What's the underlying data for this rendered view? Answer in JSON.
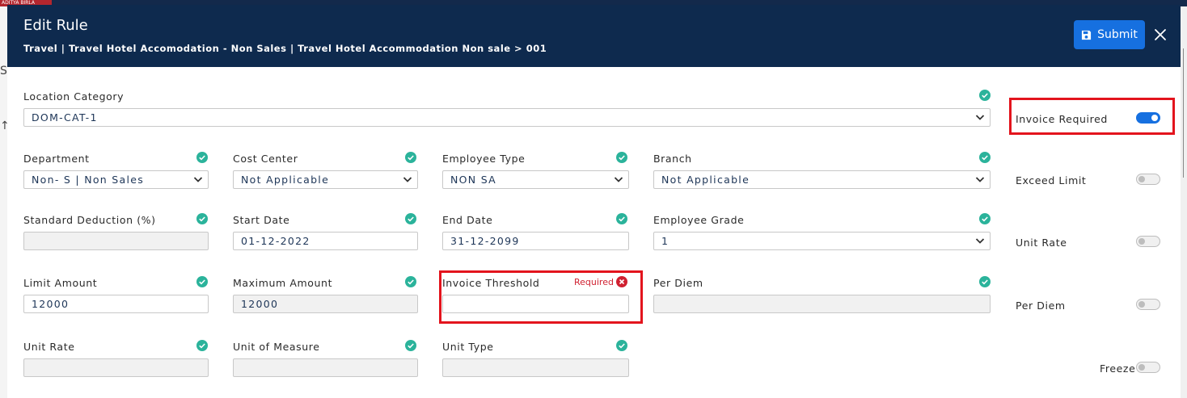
{
  "background": {
    "logo_text": "ADITYA BIRLA",
    "glyph_top": "S",
    "glyph_mid": "↑"
  },
  "header": {
    "title": "Edit Rule",
    "breadcrumb": "Travel | Travel Hotel Accomodation - Non Sales | Travel Hotel Accommodation Non sale > 001",
    "submit_label": "Submit"
  },
  "fields": {
    "location_category": {
      "label": "Location Category",
      "value": "DOM-CAT-1"
    },
    "department": {
      "label": "Department",
      "value": "Non- S | Non Sales"
    },
    "cost_center": {
      "label": "Cost Center",
      "value": "Not Applicable"
    },
    "employee_type": {
      "label": "Employee Type",
      "value": "NON SA"
    },
    "branch": {
      "label": "Branch",
      "value": "Not Applicable"
    },
    "standard_deduction": {
      "label": "Standard Deduction (%)",
      "value": ""
    },
    "start_date": {
      "label": "Start Date",
      "value": "01-12-2022"
    },
    "end_date": {
      "label": "End Date",
      "value": "31-12-2099"
    },
    "employee_grade": {
      "label": "Employee Grade",
      "value": "1"
    },
    "limit_amount": {
      "label": "Limit Amount",
      "value": "12000"
    },
    "maximum_amount": {
      "label": "Maximum Amount",
      "value": "12000"
    },
    "invoice_threshold": {
      "label": "Invoice Threshold",
      "value": "",
      "error": "Required"
    },
    "per_diem": {
      "label": "Per Diem",
      "value": ""
    },
    "unit_rate": {
      "label": "Unit Rate",
      "value": ""
    },
    "unit_of_measure": {
      "label": "Unit of Measure",
      "value": ""
    },
    "unit_type": {
      "label": "Unit Type",
      "value": ""
    }
  },
  "toggles": {
    "invoice_required": {
      "label": "Invoice Required",
      "on": true
    },
    "exceed_limit": {
      "label": "Exceed Limit",
      "on": false
    },
    "unit_rate": {
      "label": "Unit Rate",
      "on": false
    },
    "per_diem": {
      "label": "Per Diem",
      "on": false
    },
    "freeze": {
      "label": "Freeze",
      "on": false
    }
  },
  "colors": {
    "header_bg": "#0e2a4e",
    "primary": "#1670e0",
    "check": "#2bb39b",
    "error": "#d02030",
    "highlight": "#e3141d"
  }
}
